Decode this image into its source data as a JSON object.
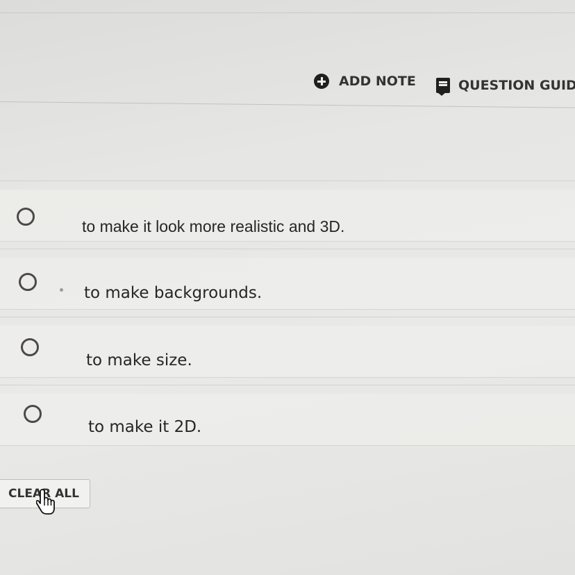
{
  "toolbar": {
    "add_note_label": "ADD NOTE",
    "question_guide_label": "QUESTION GUIDE"
  },
  "options": [
    {
      "label": "to make it look more realistic and 3D.",
      "selected": false
    },
    {
      "label": "to make backgrounds.",
      "selected": false
    },
    {
      "label": "to make size.",
      "selected": false
    },
    {
      "label": "to make it 2D.",
      "selected": false
    }
  ],
  "actions": {
    "clear_all_label": "CLEAR ALL"
  },
  "icons": {
    "add_note": "plus-circle-icon",
    "question_guide": "note-bubble-icon",
    "cursor": "hand-pointer-icon"
  },
  "colors": {
    "background": "#e6e6e4",
    "text": "#262626",
    "icon": "#1f1f1f"
  }
}
